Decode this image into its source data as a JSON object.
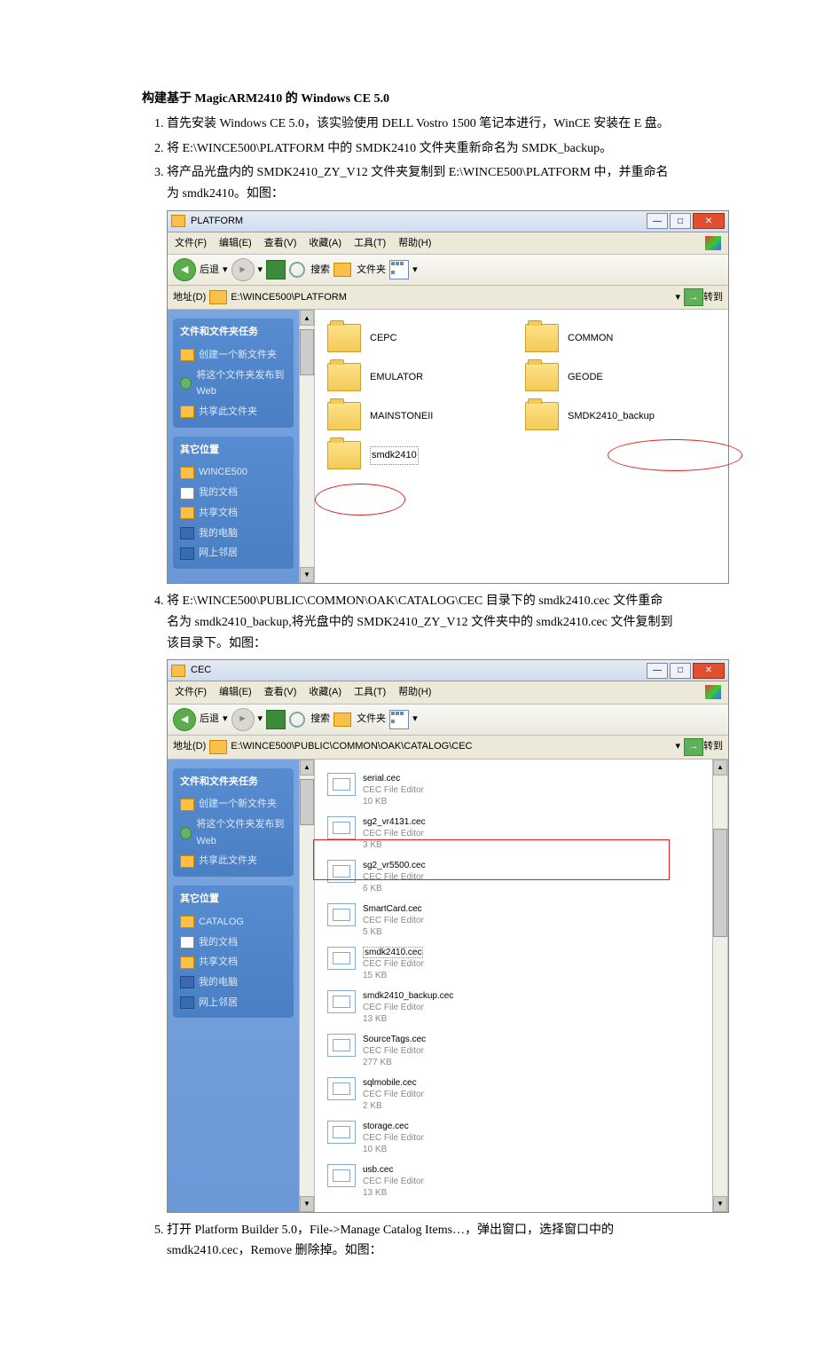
{
  "doc": {
    "title": "构建基于 MagicARM2410 的 Windows CE 5.0",
    "steps": [
      "首先安装 Windows CE 5.0，该实验使用 DELL Vostro 1500 笔记本进行，WinCE 安装在 E 盘。",
      "将 E:\\WINCE500\\PLATFORM 中的 SMDK2410 文件夹重新命名为 SMDK_backup。",
      "将产品光盘内的 SMDK2410_ZY_V12 文件夹复制到 E:\\WINCE500\\PLATFORM 中，并重命名为 smdk2410。如图：",
      "将 E:\\WINCE500\\PUBLIC\\COMMON\\OAK\\CATALOG\\CEC 目录下的 smdk2410.cec 文件重命名为 smdk2410_backup,将光盘中的 SMDK2410_ZY_V12 文件夹中的 smdk2410.cec 文件复制到该目录下。如图：",
      "打开 Platform Builder 5.0，File->Manage Catalog Items…，弹出窗口，选择窗口中的 smdk2410.cec，Remove 删除掉。如图："
    ]
  },
  "win1": {
    "title": "PLATFORM",
    "menu": [
      "文件(F)",
      "编辑(E)",
      "查看(V)",
      "收藏(A)",
      "工具(T)",
      "帮助(H)"
    ],
    "tb": {
      "back": "后退",
      "search": "搜索",
      "folders": "文件夹"
    },
    "addrLabel": "地址(D)",
    "address": "E:\\WINCE500\\PLATFORM",
    "go": "转到",
    "task": {
      "header": "文件和文件夹任务",
      "items": [
        "创建一个新文件夹",
        "将这个文件夹发布到 Web",
        "共享此文件夹"
      ]
    },
    "other": {
      "header": "其它位置",
      "items": [
        "WINCE500",
        "我的文档",
        "共享文档",
        "我的电脑",
        "网上邻居"
      ]
    },
    "folders": [
      "CEPC",
      "COMMON",
      "EMULATOR",
      "GEODE",
      "MAINSTONEII",
      "SMDK2410_backup",
      "smdk2410"
    ]
  },
  "win2": {
    "title": "CEC",
    "menu": [
      "文件(F)",
      "编辑(E)",
      "查看(V)",
      "收藏(A)",
      "工具(T)",
      "帮助(H)"
    ],
    "tb": {
      "back": "后退",
      "search": "搜索",
      "folders": "文件夹"
    },
    "addrLabel": "地址(D)",
    "address": "E:\\WINCE500\\PUBLIC\\COMMON\\OAK\\CATALOG\\CEC",
    "go": "转到",
    "task": {
      "header": "文件和文件夹任务",
      "items": [
        "创建一个新文件夹",
        "将这个文件夹发布到 Web",
        "共享此文件夹"
      ]
    },
    "other": {
      "header": "其它位置",
      "items": [
        "CATALOG",
        "我的文档",
        "共享文档",
        "我的电脑",
        "网上邻居"
      ]
    },
    "files": [
      {
        "n": "serial.cec",
        "t": "CEC File Editor",
        "s": "10 KB"
      },
      {
        "n": "sg2_vr4131.cec",
        "t": "CEC File Editor",
        "s": "3 KB"
      },
      {
        "n": "sg2_vr5500.cec",
        "t": "CEC File Editor",
        "s": "6 KB"
      },
      {
        "n": "SmartCard.cec",
        "t": "CEC File Editor",
        "s": "5 KB"
      },
      {
        "n": "smdk2410.cec",
        "t": "CEC File Editor",
        "s": "15 KB"
      },
      {
        "n": "smdk2410_backup.cec",
        "t": "CEC File Editor",
        "s": "13 KB"
      },
      {
        "n": "SourceTags.cec",
        "t": "CEC File Editor",
        "s": "277 KB"
      },
      {
        "n": "sqlmobile.cec",
        "t": "CEC File Editor",
        "s": "2 KB"
      },
      {
        "n": "storage.cec",
        "t": "CEC File Editor",
        "s": "10 KB"
      },
      {
        "n": "usb.cec",
        "t": "CEC File Editor",
        "s": "13 KB"
      }
    ]
  }
}
